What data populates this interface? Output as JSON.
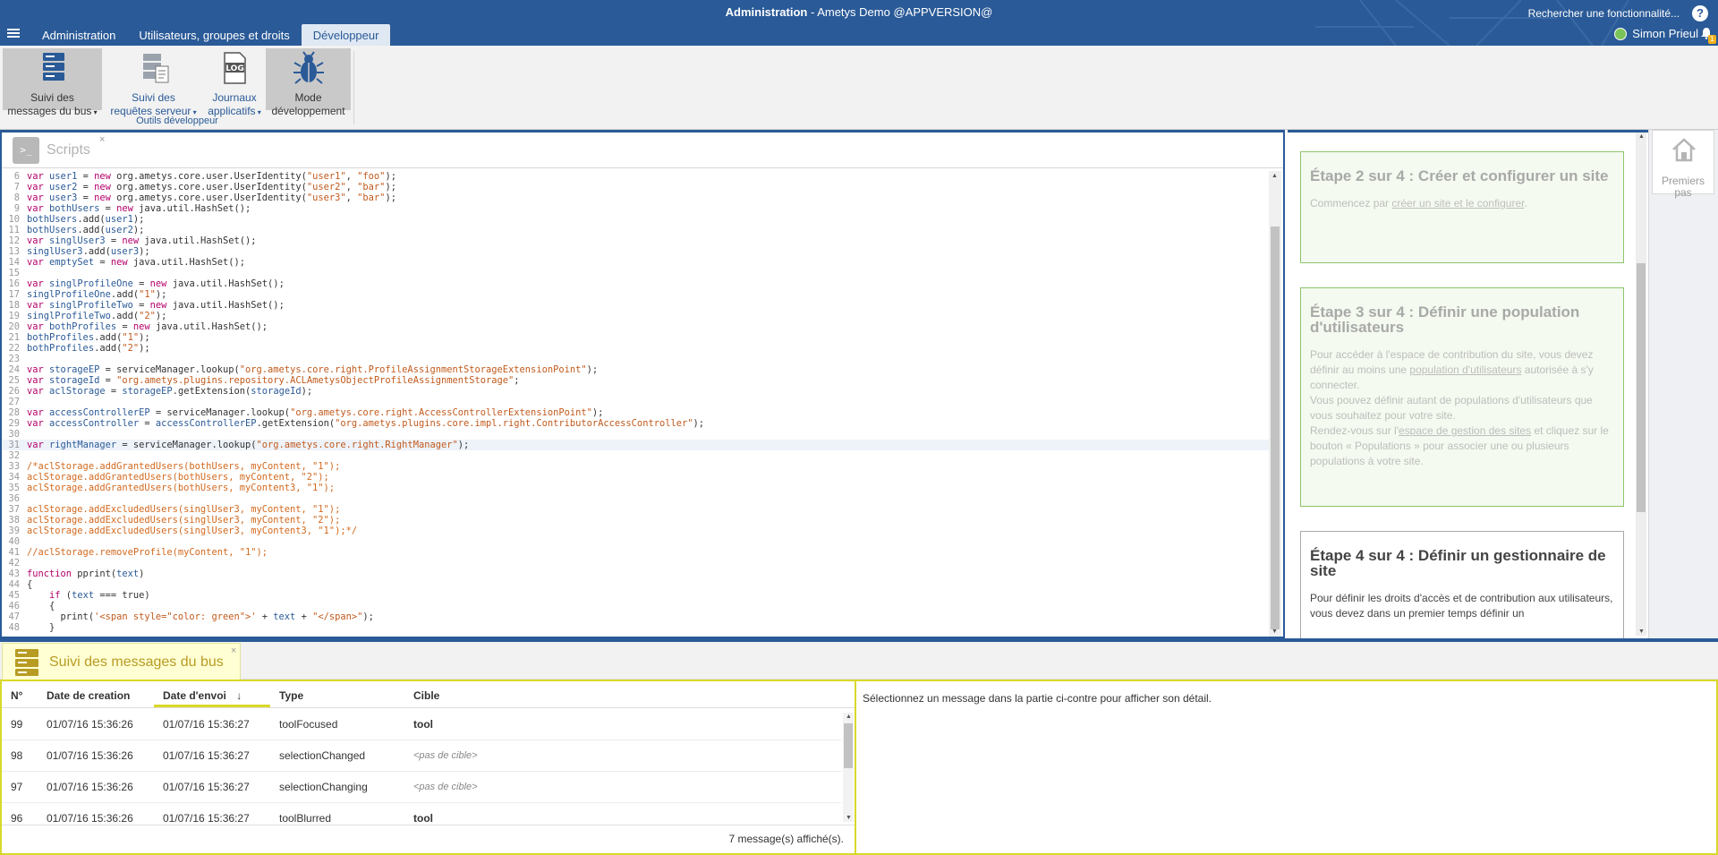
{
  "header": {
    "title_app": "Administration",
    "title_sep": " - ",
    "title_site": "Ametys Demo @APPVERSION@",
    "search_text": "Rechercher une fonctionnalité...",
    "help_label": "?",
    "user_name": "Simon Prieul",
    "notif_count": "1",
    "tabs": [
      {
        "label": "Administration"
      },
      {
        "label": "Utilisateurs, groupes et droits"
      },
      {
        "label": "Développeur"
      }
    ]
  },
  "ribbon": {
    "buttons": [
      {
        "line1": "Suivi des",
        "line2": "messages du bus",
        "icon": "server-stack-icon"
      },
      {
        "line1": "Suivi des",
        "line2": "requêtes serveur",
        "icon": "server-requests-icon"
      },
      {
        "line1": "Journaux",
        "line2": "applicatifs",
        "icon": "log-file-icon",
        "icon_text": "LOG"
      },
      {
        "line1": "Mode",
        "line2": "développement",
        "icon": "bug-icon"
      }
    ],
    "group_label": "Outils développeur"
  },
  "scripts": {
    "tab_title": "Scripts",
    "icon_text": ">_",
    "close": "×"
  },
  "code_lines": [
    {
      "n": "6",
      "t": "var user1 = new org.ametys.core.user.UserIdentity(\"user1\", \"foo\");"
    },
    {
      "n": "7",
      "t": "var user2 = new org.ametys.core.user.UserIdentity(\"user2\", \"bar\");"
    },
    {
      "n": "8",
      "t": "var user3 = new org.ametys.core.user.UserIdentity(\"user3\", \"bar\");"
    },
    {
      "n": "9",
      "t": "var bothUsers = new java.util.HashSet();"
    },
    {
      "n": "10",
      "t": "bothUsers.add(user1);"
    },
    {
      "n": "11",
      "t": "bothUsers.add(user2);"
    },
    {
      "n": "12",
      "t": "var singlUser3 = new java.util.HashSet();"
    },
    {
      "n": "13",
      "t": "singlUser3.add(user3);"
    },
    {
      "n": "14",
      "t": "var emptySet = new java.util.HashSet();"
    },
    {
      "n": "15",
      "t": ""
    },
    {
      "n": "16",
      "t": "var singlProfileOne = new java.util.HashSet();"
    },
    {
      "n": "17",
      "t": "singlProfileOne.add(\"1\");"
    },
    {
      "n": "18",
      "t": "var singlProfileTwo = new java.util.HashSet();"
    },
    {
      "n": "19",
      "t": "singlProfileTwo.add(\"2\");"
    },
    {
      "n": "20",
      "t": "var bothProfiles = new java.util.HashSet();"
    },
    {
      "n": "21",
      "t": "bothProfiles.add(\"1\");"
    },
    {
      "n": "22",
      "t": "bothProfiles.add(\"2\");"
    },
    {
      "n": "23",
      "t": ""
    },
    {
      "n": "24",
      "t": "var storageEP = serviceManager.lookup(\"org.ametys.core.right.ProfileAssignmentStorageExtensionPoint\");"
    },
    {
      "n": "25",
      "t": "var storageId = \"org.ametys.plugins.repository.ACLAmetysObjectProfileAssignmentStorage\";"
    },
    {
      "n": "26",
      "t": "var aclStorage = storageEP.getExtension(storageId);"
    },
    {
      "n": "27",
      "t": ""
    },
    {
      "n": "28",
      "t": "var accessControllerEP = serviceManager.lookup(\"org.ametys.core.right.AccessControllerExtensionPoint\");"
    },
    {
      "n": "29",
      "t": "var accessController = accessControllerEP.getExtension(\"org.ametys.plugins.core.impl.right.ContributorAccessController\");"
    },
    {
      "n": "30",
      "t": ""
    },
    {
      "n": "31",
      "t": "var rightManager = serviceManager.lookup(\"org.ametys.core.right.RightManager\");"
    },
    {
      "n": "32",
      "t": ""
    },
    {
      "n": "33",
      "t": "/*aclStorage.addGrantedUsers(bothUsers, myContent, \"1\");"
    },
    {
      "n": "34",
      "t": "aclStorage.addGrantedUsers(bothUsers, myContent, \"2\");"
    },
    {
      "n": "35",
      "t": "aclStorage.addGrantedUsers(bothUsers, myContent3, \"1\");"
    },
    {
      "n": "36",
      "t": ""
    },
    {
      "n": "37",
      "t": "aclStorage.addExcludedUsers(singlUser3, myContent, \"1\");"
    },
    {
      "n": "38",
      "t": "aclStorage.addExcludedUsers(singlUser3, myContent, \"2\");"
    },
    {
      "n": "39",
      "t": "aclStorage.addExcludedUsers(singlUser3, myContent3, \"1\");*/"
    },
    {
      "n": "40",
      "t": ""
    },
    {
      "n": "41",
      "t": "//aclStorage.removeProfile(myContent, \"1\");"
    },
    {
      "n": "42",
      "t": ""
    },
    {
      "n": "43",
      "t": "function pprint(text)"
    },
    {
      "n": "44",
      "t": "{"
    },
    {
      "n": "45",
      "t": "    if (text === true)"
    },
    {
      "n": "46",
      "t": "    {"
    },
    {
      "n": "47",
      "t": "      print('<span style=\"color: green\">' + text + \"</span>\");"
    },
    {
      "n": "48",
      "t": "    }"
    }
  ],
  "help_steps": [
    {
      "title": "Étape 2 sur 4 : Créer et configurer un site",
      "paras": [
        {
          "pre": "Commencez par ",
          "link": "créer un site et le configurer",
          "post": "."
        }
      ]
    },
    {
      "title": "Étape 3 sur 4 : Définir une population d'utilisateurs",
      "paras": [
        {
          "pre": "Pour accéder à l'espace de contribution du site, vous devez définir au moins une ",
          "link": "population d'utilisateurs",
          "post": " autorisée à s'y connecter."
        },
        {
          "pre": "Vous pouvez définir autant de populations d'utilisateurs que vous souhaitez pour votre site.",
          "link": "",
          "post": ""
        },
        {
          "pre": "Rendez-vous sur l'",
          "link": "espace de gestion des sites",
          "post": " et cliquez sur le bouton « Populations » pour associer une ou plusieurs populations à votre site."
        }
      ]
    },
    {
      "title": "Étape 4 sur 4 : Définir un gestionnaire de site",
      "paras": [
        {
          "pre": "Pour définir les droits d'accès et de contribution aux utilisateurs, vous devez dans un premier temps définir un",
          "link": "",
          "post": ""
        }
      ]
    }
  ],
  "premiers_pas": {
    "line1": "Premiers",
    "line2": "pas"
  },
  "bus": {
    "tab_title": "Suivi des messages du bus",
    "close": "×",
    "columns": [
      "N°",
      "Date de creation",
      "Date d'envoi",
      "Type",
      "Cible"
    ],
    "sort_arrow": "↓",
    "rows": [
      {
        "num": "99",
        "created": "01/07/16 15:36:26",
        "sent": "01/07/16 15:36:27",
        "type": "toolFocused",
        "target": "tool",
        "target_style": "bold"
      },
      {
        "num": "98",
        "created": "01/07/16 15:36:26",
        "sent": "01/07/16 15:36:27",
        "type": "selectionChanged",
        "target": "<pas de cible>",
        "target_style": "ital"
      },
      {
        "num": "97",
        "created": "01/07/16 15:36:26",
        "sent": "01/07/16 15:36:27",
        "type": "selectionChanging",
        "target": "<pas de cible>",
        "target_style": "ital"
      },
      {
        "num": "96",
        "created": "01/07/16 15:36:26",
        "sent": "01/07/16 15:36:27",
        "type": "toolBlurred",
        "target": "tool",
        "target_style": "bold"
      }
    ],
    "footer": "7 message(s) affiché(s).",
    "detail_text": "Sélectionnez un message dans la partie ci-contre pour afficher son détail."
  },
  "colors": {
    "brand": "#2a5a97",
    "bus_accent": "#d8d82a",
    "step_done": "#8cc46a"
  }
}
